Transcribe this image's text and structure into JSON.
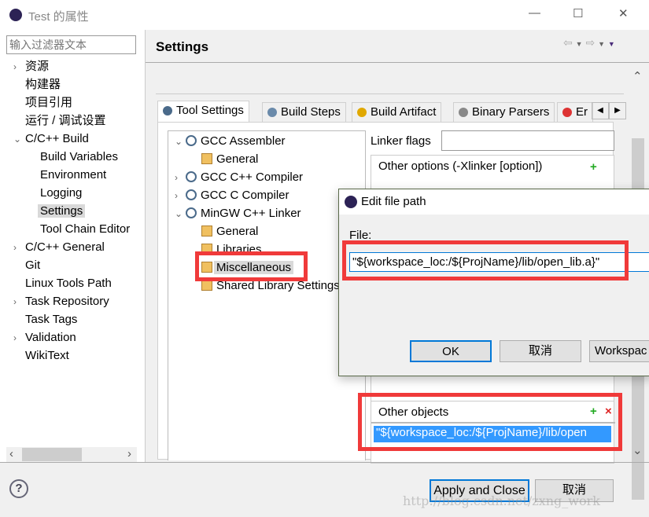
{
  "window": {
    "title": "Test 的属性",
    "minimize": "—",
    "maximize": "☐",
    "close": "✕"
  },
  "filter": {
    "placeholder": "输入过滤器文本"
  },
  "sidebar": {
    "items": [
      {
        "label": "资源",
        "expandable": true,
        "level": 0
      },
      {
        "label": "构建器",
        "level": 0
      },
      {
        "label": "项目引用",
        "level": 0
      },
      {
        "label": "运行 / 调试设置",
        "level": 0
      },
      {
        "label": "C/C++ Build",
        "expanded": true,
        "level": 0
      },
      {
        "label": "Build Variables",
        "level": 1
      },
      {
        "label": "Environment",
        "level": 1
      },
      {
        "label": "Logging",
        "level": 1
      },
      {
        "label": "Settings",
        "level": 1,
        "selected": true
      },
      {
        "label": "Tool Chain Editor",
        "level": 1
      },
      {
        "label": "C/C++ General",
        "expandable": true,
        "level": 0
      },
      {
        "label": "Git",
        "level": 0
      },
      {
        "label": "Linux Tools Path",
        "level": 0
      },
      {
        "label": "Task Repository",
        "expandable": true,
        "level": 0
      },
      {
        "label": "Task Tags",
        "level": 0
      },
      {
        "label": "Validation",
        "expandable": true,
        "level": 0
      },
      {
        "label": "WikiText",
        "level": 0
      }
    ]
  },
  "header": {
    "title": "Settings"
  },
  "tabs": [
    {
      "label": "Tool Settings",
      "icon": "tool-settings-icon",
      "active": true
    },
    {
      "label": "Build Steps",
      "icon": "build-steps-icon"
    },
    {
      "label": "Build Artifact",
      "icon": "trophy-icon"
    },
    {
      "label": "Binary Parsers",
      "icon": "binary-icon"
    },
    {
      "label": "Er",
      "icon": "error-icon"
    }
  ],
  "tool_tree": [
    {
      "label": "GCC Assembler",
      "level": 0,
      "expanded": true
    },
    {
      "label": "General",
      "level": 1
    },
    {
      "label": "GCC C++ Compiler",
      "level": 0,
      "expandable": true
    },
    {
      "label": "GCC C Compiler",
      "level": 0,
      "expandable": true
    },
    {
      "label": "MinGW C++ Linker",
      "level": 0,
      "expanded": true
    },
    {
      "label": "General",
      "level": 1
    },
    {
      "label": "Libraries",
      "level": 1
    },
    {
      "label": "Miscellaneous",
      "level": 1,
      "selected": true
    },
    {
      "label": "Shared Library Settings",
      "level": 1
    }
  ],
  "linker": {
    "flags_label": "Linker flags",
    "flags_value": "",
    "other_options_label": "Other options (-Xlinker [option])",
    "other_objects_label": "Other objects",
    "other_objects_items": [
      "\"${workspace_loc:/${ProjName}/lib/open"
    ]
  },
  "dialog": {
    "title": "Edit file path",
    "file_label": "File:",
    "file_value": "\"${workspace_loc:/${ProjName}/lib/open_lib.a}\"",
    "ok": "OK",
    "cancel": "取消",
    "workspace": "Workspac"
  },
  "footer": {
    "apply_close": "Apply and Close",
    "cancel": "取消",
    "watermark": "http://blog.csdn.net/zxng_work"
  },
  "colors": {
    "highlight": "#3399ff",
    "annotation_red": "#f03a3a",
    "focus_blue": "#0078d7"
  }
}
